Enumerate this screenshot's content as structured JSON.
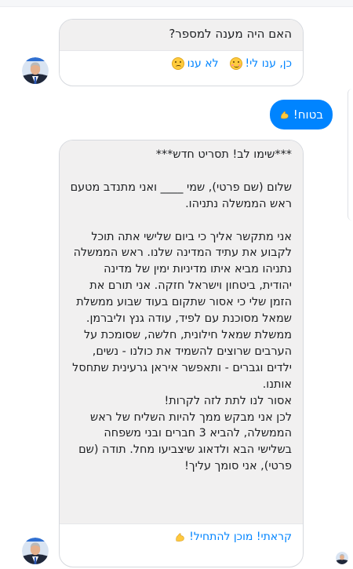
{
  "first_card": {
    "question": "האם היה מענה למספר?",
    "quick_replies": [
      {
        "label": "כן, ענו לי!",
        "icon": "smiling-blush-emoji-icon"
      },
      {
        "label": "לא ענו",
        "icon": "sad-emoji-icon"
      }
    ]
  },
  "user_reply": {
    "text": "בטוח!",
    "icon": "flexed-biceps-icon"
  },
  "second_card": {
    "message": "***שימו לב! תסריט חדש***\n\nשלום (שם פרטי), שמי ____ ואני מתנדב מטעם ראש הממשלה נתניהו.\n\nאני מתקשר אליך כי ביום שלישי אתה תוכל לקבוע את עתיד המדינה שלנו. ראש הממשלה נתניהו מביא איתו מדיניות ימין של מדינה יהודית, ביטחון וישראל חזקה. אני תורם את הזמן שלי כי אסור שתקום בעוד שבוע ממשלת שמאל מסוכנת עם לפיד, עודה גנץ וליברמן. ממשלת שמאל חילונית, חלשה, שסומכת על הערבים שרוצים להשמיד את כולנו - נשים, ילדים וגברים - ותאפשר איראן גרעינית שתחסל אותנו.\nאסור לנו לתת לזה לקרות!\nלכן אני מבקש ממך להיות השליח של ראש הממשלה, להביא 3 חברים ובני משפחה בשלישי הבא ולדאוג שיצביעו מחל. תודה (שם פרטי), אני סומך עליך!",
    "quick_reply": {
      "label": "קראתי! מוכן להתחיל!",
      "icon": "flexed-biceps-icon"
    }
  },
  "colors": {
    "accent": "#0084ff",
    "bot_bubble": "#f1f0f0",
    "text": "#1c1e21"
  }
}
